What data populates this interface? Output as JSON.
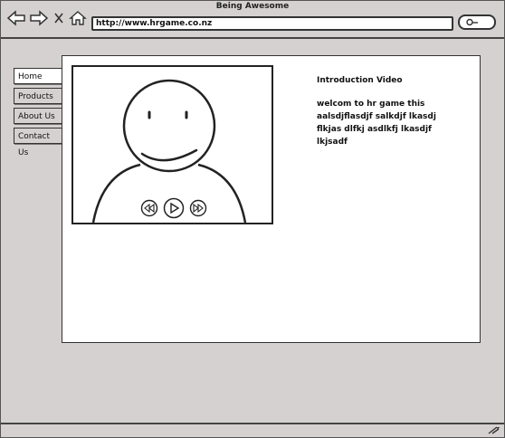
{
  "window": {
    "title": "Being Awesome"
  },
  "browser": {
    "url": "http://www.hrgame.co.nz",
    "icons": [
      "back-arrow-icon",
      "forward-arrow-icon",
      "close-x-icon",
      "home-icon",
      "search-icon"
    ]
  },
  "sidebar": {
    "items": [
      {
        "label": "Home",
        "active": true
      },
      {
        "label": "Products",
        "active": false
      },
      {
        "label": "About Us",
        "active": false
      },
      {
        "label": "Contact Us",
        "active": false
      }
    ]
  },
  "video": {
    "controls": [
      "rewind-icon",
      "play-icon",
      "fast-forward-icon"
    ]
  },
  "intro": {
    "title": "Introduction Video",
    "text": "welcom to hr game this aalsdjflasdjf salkdjf lkasdj flkjas dlfkj asdlkfj lkasdjf lkjsadf"
  }
}
